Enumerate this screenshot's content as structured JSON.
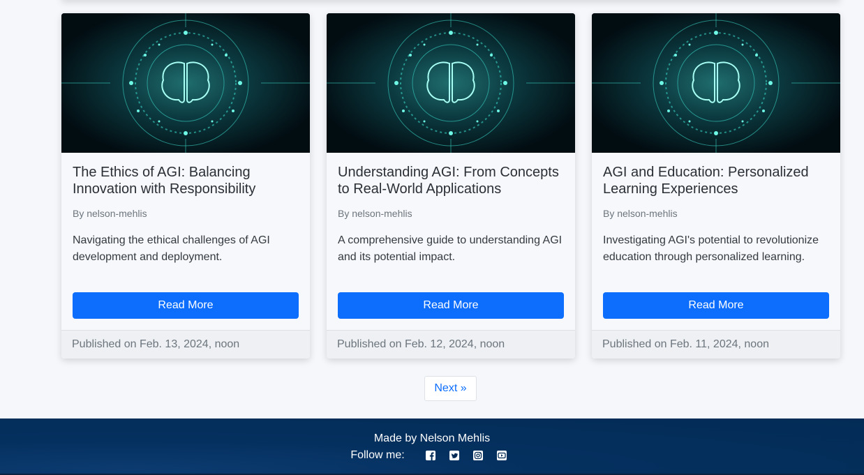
{
  "cards": [
    {
      "image_alt": "AGI brain illustration",
      "title": "The Ethics of AGI: Balancing Innovation with Responsibility",
      "author": "By nelson-mehlis",
      "description": "Navigating the ethical challenges of AGI development and deployment.",
      "button_label": "Read More",
      "published": "Published on Feb. 13, 2024, noon"
    },
    {
      "image_alt": "AGI brain illustration",
      "title": "Understanding AGI: From Concepts to Real-World Applications",
      "author": "By nelson-mehlis",
      "description": "A comprehensive guide to understanding AGI and its potential impact.",
      "button_label": "Read More",
      "published": "Published on Feb. 12, 2024, noon"
    },
    {
      "image_alt": "AGI brain illustration",
      "title": "AGI and Education: Personalized Learning Experiences",
      "author": "By nelson-mehlis",
      "description": "Investigating AGI's potential to revolutionize education through personalized learning.",
      "button_label": "Read More",
      "published": "Published on Feb. 11, 2024, noon"
    }
  ],
  "pagination": {
    "next_label": "Next »"
  },
  "footer": {
    "made_by": "Made by Nelson Mehlis",
    "follow_label": "Follow me:",
    "social_icons": [
      "facebook-icon",
      "twitter-icon",
      "instagram-icon",
      "youtube-icon"
    ]
  },
  "colors": {
    "primary": "#0d6efd",
    "footer_bg": "#032b56",
    "page_bg": "#f5f7fb"
  }
}
